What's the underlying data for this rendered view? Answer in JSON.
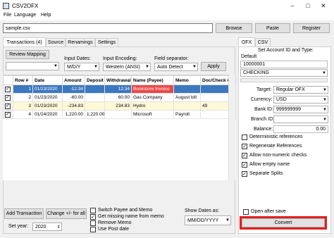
{
  "app": {
    "title": "CSV2OFX"
  },
  "menu": [
    "File",
    "Language",
    "Help"
  ],
  "file": {
    "path": "sample.csv",
    "browse": "Browse",
    "paste": "Paste",
    "register": "Register"
  },
  "left_tabs": [
    "Transactions (4)",
    "Source",
    "Renamings",
    "Settings"
  ],
  "controls": {
    "review_mapping": "Review Mapping",
    "input_dates_label": "Input Dates:",
    "input_dates": "M/D/Y",
    "input_encoding_label": "Input Encoding:",
    "input_encoding": "Western (ANSI)",
    "field_sep_label": "Field separator:",
    "field_sep": "Auto Detect",
    "apply": "Apply",
    "col_select": ""
  },
  "table": {
    "headers": [
      "",
      "Row #",
      "Date",
      "Amount",
      "Deposit",
      "Withdrawal",
      "Name (Payee)",
      "Memo",
      "Doc/Check #"
    ],
    "rows": [
      {
        "checked": true,
        "row": "1",
        "date": "01/23/2020",
        "amount": "-12.34",
        "deposit": "",
        "withdrawal": "12.34",
        "name": "Bookstore Invoice",
        "memo": "",
        "doc": ""
      },
      {
        "checked": true,
        "row": "2",
        "date": "01/23/2020",
        "amount": "-60.00",
        "deposit": "",
        "withdrawal": "60.00",
        "name": "Gas Company",
        "memo": "August bill",
        "doc": ""
      },
      {
        "checked": true,
        "row": "3",
        "date": "01/23/2020",
        "amount": "-234.83",
        "deposit": "",
        "withdrawal": "234.83",
        "name": "Hydro",
        "memo": "",
        "doc": "49"
      },
      {
        "checked": true,
        "row": "4",
        "date": "01/24/2020",
        "amount": "1,220.00",
        "deposit": "1,220.00",
        "withdrawal": "",
        "name": "Microsoft",
        "memo": "Payroll",
        "doc": ""
      }
    ]
  },
  "bottom": {
    "add_transaction": "Add Transaction",
    "change_sign": "Change +/- for all",
    "set_year_label": "Set year:",
    "set_year": "2020",
    "checks": [
      {
        "label": "Switch Payee and Memo",
        "checked": false
      },
      {
        "label": "Get missing name from memo",
        "checked": true
      },
      {
        "label": "Remove Memo",
        "checked": false
      },
      {
        "label": "Use Post date",
        "checked": false
      }
    ],
    "show_dates_label": "Show Dates as:",
    "show_dates": "MM/DD/YYYY"
  },
  "right": {
    "tabs": [
      "OFX",
      "CSV"
    ],
    "default_label": "Default",
    "set_account_label": "Set Account ID and Type:",
    "account_id": "10000001",
    "account_type": "CHECKING",
    "target_label": "Target:",
    "target": "Regular OFX",
    "currency_label": "Currency:",
    "currency": "USD",
    "bank_id_label": "Bank ID:",
    "bank_id": "999999999",
    "branch_id_label": "Branch ID:",
    "branch_id": "",
    "balance_label": "Balance:",
    "balance": "0.00",
    "options": [
      {
        "label": "Deterministic references",
        "checked": false
      },
      {
        "label": "Regenerate References",
        "checked": true
      },
      {
        "label": "Allow non-numeric checks",
        "checked": true
      },
      {
        "label": "Allow empty name",
        "checked": true
      },
      {
        "label": "Separate Splits",
        "checked": true
      }
    ],
    "open_after_save": "Open after save",
    "convert": "Convert"
  },
  "colors": {
    "selection": "#3c78c0",
    "highlight": "#e94a4a",
    "convert_border": "#e02020",
    "yellow_row": "#fff9d8"
  }
}
